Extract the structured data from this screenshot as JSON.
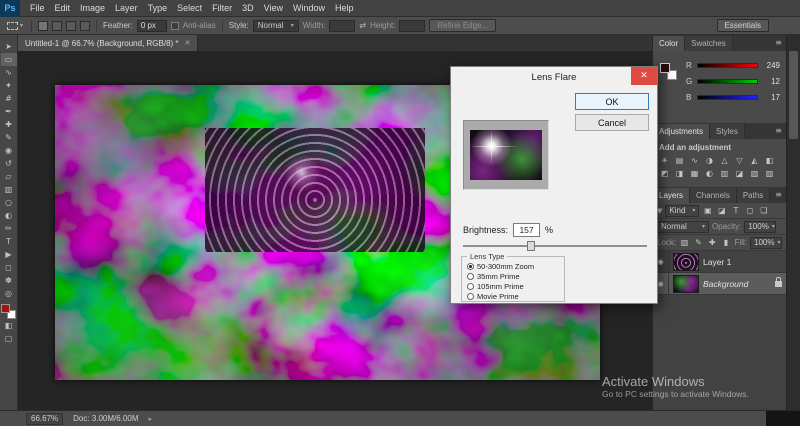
{
  "app": {
    "logo": "Ps"
  },
  "menubar": {
    "items": [
      "File",
      "Edit",
      "Image",
      "Layer",
      "Type",
      "Select",
      "Filter",
      "3D",
      "View",
      "Window",
      "Help"
    ]
  },
  "optionsbar": {
    "feather_label": "Feather:",
    "feather_value": "0 px",
    "antialias_label": "Anti-alias",
    "style_label": "Style:",
    "style_value": "Normal",
    "width_label": "Width:",
    "height_label": "Height:",
    "refine_edge_label": "Refine Edge...",
    "workspace_label": "Essentials"
  },
  "tabbar": {
    "doc_title": "Untitled-1 @ 66.7% (Background, RGB/8) *"
  },
  "toolbar": {
    "tools": [
      {
        "name": "move-tool",
        "glyph": "➤"
      },
      {
        "name": "rectangular-marquee-tool",
        "glyph": "▭"
      },
      {
        "name": "lasso-tool",
        "glyph": "∿"
      },
      {
        "name": "quick-selection-tool",
        "glyph": "✦"
      },
      {
        "name": "crop-tool",
        "glyph": "#"
      },
      {
        "name": "eyedropper-tool",
        "glyph": "✒"
      },
      {
        "name": "healing-brush-tool",
        "glyph": "✚"
      },
      {
        "name": "brush-tool",
        "glyph": "✎"
      },
      {
        "name": "clone-stamp-tool",
        "glyph": "◉"
      },
      {
        "name": "history-brush-tool",
        "glyph": "↺"
      },
      {
        "name": "eraser-tool",
        "glyph": "▱"
      },
      {
        "name": "gradient-tool",
        "glyph": "▥"
      },
      {
        "name": "blur-tool",
        "glyph": "○"
      },
      {
        "name": "dodge-tool",
        "glyph": "◐"
      },
      {
        "name": "pen-tool",
        "glyph": "✏"
      },
      {
        "name": "type-tool",
        "glyph": "T"
      },
      {
        "name": "path-selection-tool",
        "glyph": "▶"
      },
      {
        "name": "shape-tool",
        "glyph": "◻"
      },
      {
        "name": "hand-tool",
        "glyph": "✽"
      },
      {
        "name": "zoom-tool",
        "glyph": "◎"
      }
    ]
  },
  "dialog": {
    "title": "Lens Flare",
    "ok": "OK",
    "cancel": "Cancel",
    "brightness_label": "Brightness:",
    "brightness_value": "157",
    "brightness_unit": "%",
    "lens_type_label": "Lens Type",
    "lens_options": [
      {
        "label": "50-300mm Zoom",
        "selected": true
      },
      {
        "label": "35mm Prime",
        "selected": false
      },
      {
        "label": "105mm Prime",
        "selected": false
      },
      {
        "label": "Movie Prime",
        "selected": false
      }
    ]
  },
  "panels": {
    "color": {
      "tabs": [
        "Color",
        "Swatches"
      ],
      "channels": [
        {
          "label": "R",
          "value": "249"
        },
        {
          "label": "G",
          "value": "12"
        },
        {
          "label": "B",
          "value": "17"
        }
      ]
    },
    "adjustments": {
      "tabs": [
        "Adjustments",
        "Styles"
      ],
      "hint": "Add an adjustment",
      "icons": [
        "☀",
        "▤",
        "∿",
        "◑",
        "△",
        "▽",
        "◭",
        "◧",
        "◩",
        "◨",
        "▦",
        "◐",
        "▥",
        "◪",
        "▧",
        "▨"
      ]
    },
    "layers": {
      "tabs": [
        "Layers",
        "Channels",
        "Paths"
      ],
      "kind_label": "Kind",
      "filter_icons": [
        "▣",
        "◪",
        "T",
        "◻",
        "❏"
      ],
      "blend_mode": "Normal",
      "opacity_label": "Opacity:",
      "opacity_value": "100%",
      "lock_label": "Lock:",
      "lock_icons": [
        "▨",
        "✎",
        "✚",
        "▮"
      ],
      "fill_label": "Fill:",
      "fill_value": "100%",
      "items": [
        {
          "name": "Layer 1",
          "locked": false
        },
        {
          "name": "Background",
          "locked": true
        }
      ]
    }
  },
  "statusbar": {
    "zoom": "66.67%",
    "doc": "Doc: 3.00M/6.00M"
  },
  "watermark": {
    "line1": "Activate Windows",
    "line2": "Go to PC settings to activate Windows."
  },
  "icons": {
    "close": "✕",
    "chevron": "▾",
    "panel_menu": "≡",
    "eye": "◉",
    "swap": "⇄",
    "arrow": "▸",
    "funnel": "▼",
    "quick_mask": "◧",
    "screen_mode": "▢"
  },
  "colors": {
    "accent_blue": "#2c7ec2",
    "dialog_close_red": "#df4a42",
    "ps_logo_blue": "#52b9ff",
    "canvas_green": "#2daa23",
    "canvas_magenta": "#a019b9"
  }
}
